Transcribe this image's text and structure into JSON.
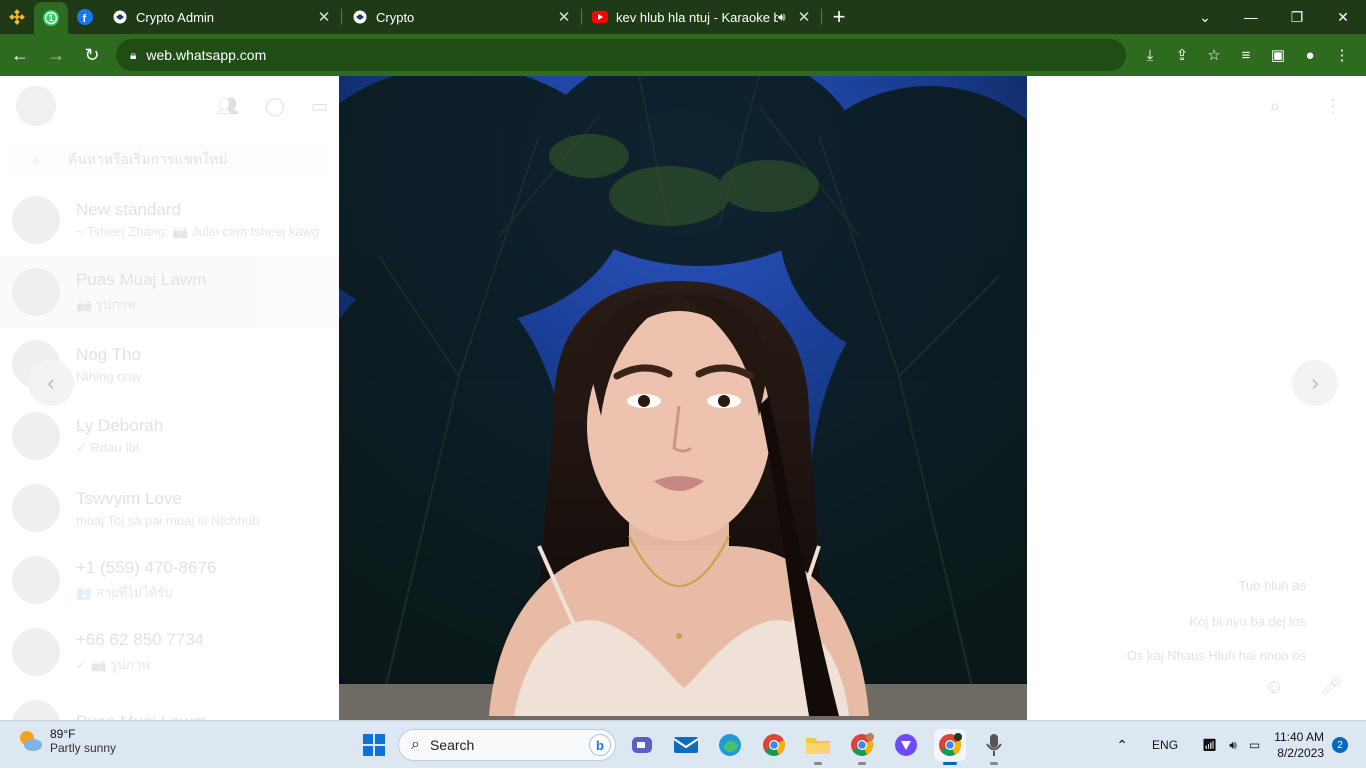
{
  "browser": {
    "tabs": [
      {
        "title": "Crypto Admin",
        "close": "✕"
      },
      {
        "title": "Crypto",
        "close": "✕"
      },
      {
        "title": "kev hlub hla ntuj - Karaoke b",
        "close": "✕"
      }
    ],
    "pinned_badge": "1",
    "new_tab": "+",
    "url": "web.whatsapp.com"
  },
  "whatsapp": {
    "search_placeholder": "ค้นหาหรือเริ่มการแชทใหม่",
    "chats": [
      {
        "name": "New standard",
        "preview": "~ Tsheej Zhang: 📷 Julai cem tsheej kawg"
      },
      {
        "name": "Puas Muaj Lawm",
        "preview": "📷 รูปภาพ"
      },
      {
        "name": "Nog Tho",
        "preview": "Nthing now"
      },
      {
        "name": "Ly Deborah",
        "preview": "✓ Rdau Ibi"
      },
      {
        "name": "Tswvyim Love",
        "preview": "muaj Toj sa pai muaj si Ntchhub"
      },
      {
        "name": "+1 (559) 470-8676",
        "preview": "👥 สายที่ไม่ได้รับ"
      },
      {
        "name": "+66 62 850 7734",
        "preview": "✓ 📷 รูปภาพ"
      },
      {
        "name": "Puas Muaj Lawm",
        "preview": ""
      }
    ],
    "messages": [
      "Tuo hluh as",
      "Koj bi nyu ba dej los",
      "Os kaj Nhaus Hluh hai nnoo os"
    ]
  },
  "taskbar": {
    "weather_temp": "89°F",
    "weather_desc": "Partly sunny",
    "search_label": "Search",
    "lang": "ENG",
    "time": "11:40 AM",
    "date": "8/2/2023",
    "notifications": "2"
  },
  "colors": {
    "tabstrip": "#1e3a16",
    "toolbar": "#2e6b1f",
    "taskbar": "#dde7f1",
    "accent": "#0067c0"
  }
}
